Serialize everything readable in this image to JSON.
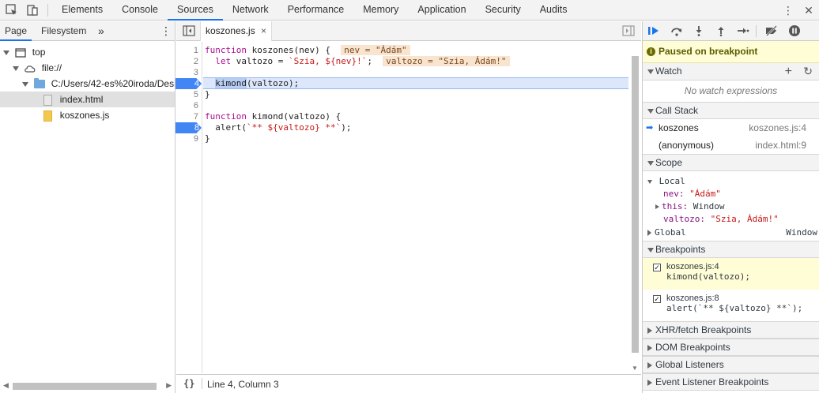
{
  "topbar": {
    "tabs": [
      "Elements",
      "Console",
      "Sources",
      "Network",
      "Performance",
      "Memory",
      "Application",
      "Security",
      "Audits"
    ],
    "active_tab": "Sources"
  },
  "navigator": {
    "tabs": [
      "Page",
      "Filesystem"
    ],
    "more": "»",
    "menu": "⋮",
    "tree": {
      "top": "top",
      "origin": "file://",
      "folder": "C:/Users/42-es%20iroda/Deskt",
      "file1": "index.html",
      "file2": "koszones.js"
    }
  },
  "editor": {
    "file_tab": "koszones.js",
    "close": "×",
    "line_numbers": [
      "1",
      "2",
      "3",
      "4",
      "5",
      "6",
      "7",
      "8",
      "9"
    ],
    "lines": {
      "l1_kw": "function",
      "l1_rest": " koszones(nev) {",
      "l1_inline": "nev = \"Ádám\"",
      "l2_kw": "let",
      "l2_mid": " valtozo = ",
      "l2_str": "`Szia, ${nev}!`",
      "l2_end": ";",
      "l2_inline": "valtozo = \"Szia, Ádám!\"",
      "l3": "",
      "l4_sel": "kimond",
      "l4_rest": "(valtozo);",
      "l5": "}",
      "l6": "",
      "l7_kw": "function",
      "l7_rest": " kimond(valtozo) {",
      "l8_call": "alert(",
      "l8_str": "`** ${valtozo} **`",
      "l8_end": ");",
      "l9": "}"
    },
    "status": {
      "braces": "{}",
      "position": "Line 4, Column 3"
    }
  },
  "debugger": {
    "paused_text": "Paused on breakpoint",
    "watch": {
      "title": "Watch",
      "empty": "No watch expressions",
      "add": "+",
      "refresh": "↻"
    },
    "call_stack": {
      "title": "Call Stack",
      "frames": [
        {
          "name": "koszones",
          "loc": "koszones.js:4"
        },
        {
          "name": "(anonymous)",
          "loc": "index.html:9"
        }
      ]
    },
    "scope": {
      "title": "Scope",
      "local": "Local",
      "nev_key": "nev:",
      "nev_val": "\"Ádám\"",
      "this_key": "this:",
      "this_val": "Window",
      "valtozo_key": "valtozo:",
      "valtozo_val": "\"Szia, Ádám!\"",
      "global": "Global",
      "global_val": "Window"
    },
    "breakpoints": {
      "title": "Breakpoints",
      "items": [
        {
          "file": "koszones.js:4",
          "code": "kimond(valtozo);"
        },
        {
          "file": "koszones.js:8",
          "code": "alert(`** ${valtozo} **`);"
        }
      ]
    },
    "sections": [
      "XHR/fetch Breakpoints",
      "DOM Breakpoints",
      "Global Listeners",
      "Event Listener Breakpoints"
    ]
  }
}
